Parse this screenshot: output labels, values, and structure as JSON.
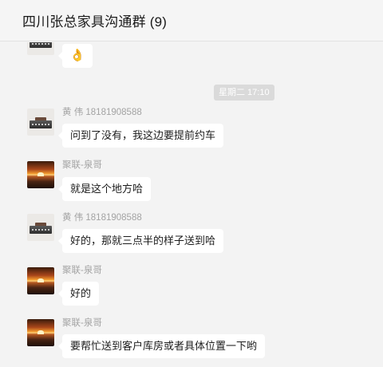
{
  "header": {
    "title": "四川张总家具沟通群 (9)"
  },
  "timestamp": "星期二 17:10",
  "messages": [
    {
      "sender": "",
      "text": "👌"
    },
    {
      "sender": "黄 伟 18181908588",
      "text": "问到了没有，我这边要提前约车"
    },
    {
      "sender": "聚联-泉哥",
      "text": "就是这个地方哈"
    },
    {
      "sender": "黄 伟 18181908588",
      "text": "好的，那就三点半的样子送到哈"
    },
    {
      "sender": "聚联-泉哥",
      "text": "好的"
    },
    {
      "sender": "聚联-泉哥",
      "text": "要帮忙送到客户库房或者具体位置一下哟"
    }
  ]
}
